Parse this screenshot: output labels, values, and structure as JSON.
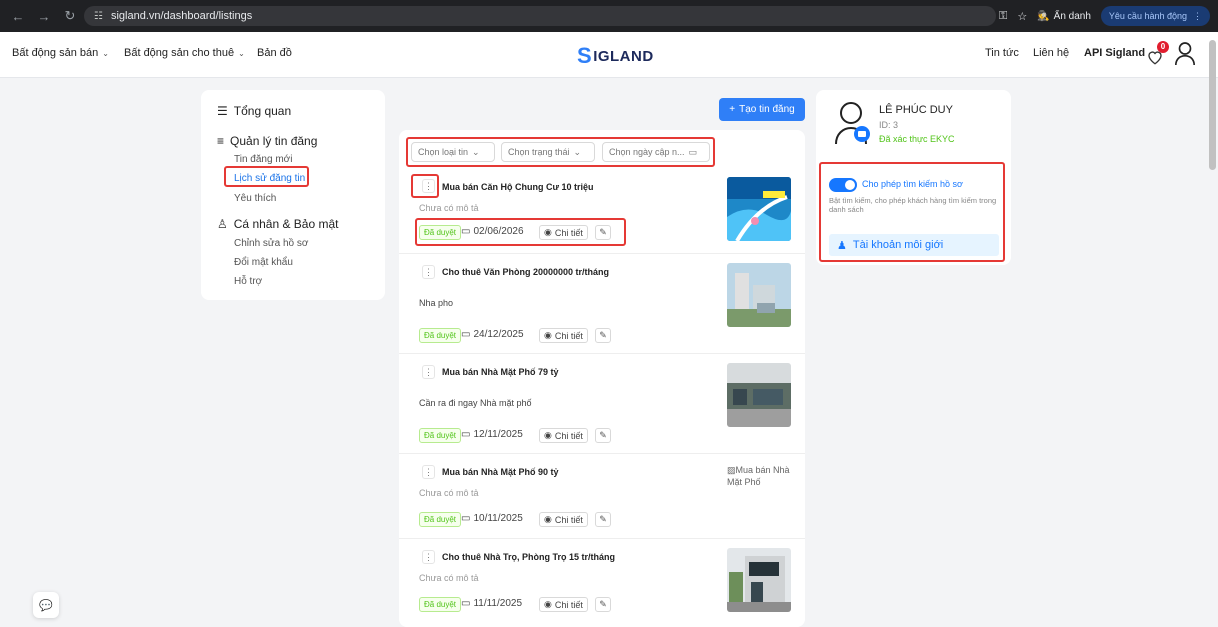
{
  "browser": {
    "url": "sigland.vn/dashboard/listings",
    "incognito_label": "Ẩn danh",
    "action_label": "Yêu cầu hành động"
  },
  "header": {
    "nav": [
      "Bất động sản bán",
      "Bất động sản cho thuê",
      "Bản đồ"
    ],
    "logo_text": "IGLAND",
    "right_links": [
      "Tin tức",
      "Liên hệ",
      "API Sigland"
    ],
    "notification_count": "0"
  },
  "sidebar": {
    "overview": "Tổng quan",
    "manage": "Quản lý tin đăng",
    "manage_items": [
      "Tin đăng mới",
      "Lịch sử đăng tin",
      "Yêu thích"
    ],
    "personal": "Cá nhân & Bảo mật",
    "personal_items": [
      "Chỉnh sửa hồ sơ",
      "Đổi mật khẩu",
      "Hỗ trợ"
    ]
  },
  "main": {
    "create_label": "Tạo tin đăng",
    "filters": {
      "type": "Chọn loại tin",
      "status": "Chọn trạng thái",
      "date": "Chọn ngày cập n..."
    },
    "detail_label": "Chi tiết",
    "listings": [
      {
        "title": "Mua bán Căn Hộ Chung Cư 10 triệu",
        "description": "Chưa có mô tả",
        "status": "Đã duyệt",
        "date": "02/06/2026"
      },
      {
        "title": "Cho thuê Văn Phòng 20000000 tr/tháng",
        "description": "Nha pho",
        "status": "Đã duyệt",
        "date": "24/12/2025"
      },
      {
        "title": "Mua bán Nhà Mặt Phố 79 tỷ",
        "description": "Cần ra đi ngay Nhà mặt phố",
        "status": "Đã duyệt",
        "date": "12/11/2025"
      },
      {
        "title": "Mua bán Nhà Mặt Phố 90 tỷ",
        "description": "Chưa có mô tả",
        "status": "Đã duyệt",
        "date": "10/11/2025",
        "image_alt": "Mua bán Nhà Mặt Phố"
      },
      {
        "title": "Cho thuê Nhà Trọ, Phòng Trọ 15 tr/tháng",
        "description": "Chưa có mô tả",
        "status": "Đã duyệt",
        "date": "11/11/2025"
      }
    ]
  },
  "profile": {
    "name": "LÊ PHÚC DUY",
    "id": "ID: 3",
    "verified": "Đã xác thực EKYC",
    "toggle_label": "Cho phép tìm kiếm hồ sơ",
    "toggle_desc": "Bật tìm kiếm, cho phép khách hàng tìm kiếm trong danh sách",
    "broker_label": "Tài khoản môi giới"
  },
  "colors": {
    "accent": "#2f7ff7",
    "status_green": "#52c41a",
    "highlight": "#e53935"
  }
}
